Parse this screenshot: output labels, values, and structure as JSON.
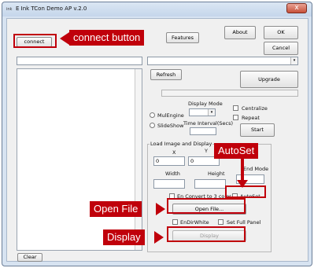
{
  "window": {
    "title": "E Ink TCon Demo AP v.2.0",
    "close_glyph": "x",
    "app_icon_text": "ink"
  },
  "toolbar": {
    "connect_label": "connect",
    "features_label": "Features",
    "about_label": "About",
    "ok_label": "OK",
    "cancel_label": "Cancel",
    "refresh_label": "Refresh",
    "upgrade_label": "Upgrade"
  },
  "fields": {
    "connect_status_value": "",
    "device_combo_value": "",
    "combo_arrow_glyph": "▾"
  },
  "display_mode": {
    "label": "Display Mode",
    "multiengine_label": "MulEngine",
    "slideshow_label": "SlideShow",
    "time_interval_label": "Time Interval(Secs)",
    "centralize_label": "Centralize",
    "repeat_label": "Repeat",
    "start_label": "Start"
  },
  "load_image": {
    "group_label": "Load Image and Display",
    "x_label": "X",
    "y_label": "Y",
    "x_value": "0",
    "y_value": "0",
    "width_label": "Width",
    "height_label": "Height",
    "end_mode_label": "End Mode",
    "convert_label": "En Convert to 3 color",
    "autoset_label": "AutoSet",
    "open_file_label": "Open File...",
    "en_dir_white_label": "EnDirWhite",
    "set_full_panel_label": "Set Full Panel",
    "display_label": "Display"
  },
  "bottom": {
    "clear_label": "Clear"
  },
  "annotations": {
    "connect_button": "connect button",
    "autoset": "AutoSet",
    "open_file": "Open File",
    "display": "Display"
  },
  "colors": {
    "annotation_red": "#c0000b",
    "window_frame": "#d7e3f1",
    "client_bg": "#f0f0f0"
  }
}
